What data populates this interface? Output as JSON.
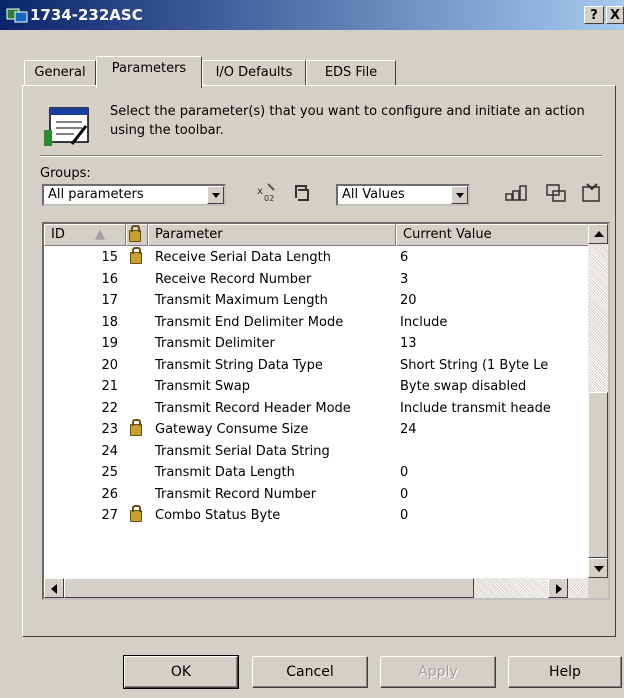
{
  "window": {
    "title": "1734-232ASC",
    "help_button": "?",
    "close_button": "X"
  },
  "tabs": [
    "General",
    "Parameters",
    "I/O Defaults",
    "EDS File"
  ],
  "active_tab": "Parameters",
  "instructions": "Select the parameter(s) that you want to configure and initiate an action using the toolbar.",
  "groups": {
    "label": "Groups:",
    "selected": "All parameters"
  },
  "values_filter": {
    "selected": "All Values"
  },
  "table": {
    "headers": {
      "id": "ID",
      "parameter": "Parameter",
      "current_value": "Current Value"
    },
    "rows": [
      {
        "id": "15",
        "locked": true,
        "parameter": "Receive Serial Data Length",
        "value": "6"
      },
      {
        "id": "16",
        "locked": false,
        "parameter": "Receive Record Number",
        "value": "3"
      },
      {
        "id": "17",
        "locked": false,
        "parameter": "Transmit Maximum Length",
        "value": "20"
      },
      {
        "id": "18",
        "locked": false,
        "parameter": "Transmit End Delimiter Mode",
        "value": "Include"
      },
      {
        "id": "19",
        "locked": false,
        "parameter": "Transmit Delimiter",
        "value": "13"
      },
      {
        "id": "20",
        "locked": false,
        "parameter": "Transmit String Data Type",
        "value": "Short String (1 Byte Le"
      },
      {
        "id": "21",
        "locked": false,
        "parameter": "Transmit Swap",
        "value": "Byte swap disabled"
      },
      {
        "id": "22",
        "locked": false,
        "parameter": "Transmit Record Header Mode",
        "value": "Include transmit heade"
      },
      {
        "id": "23",
        "locked": true,
        "parameter": "Gateway Consume Size",
        "value": "24"
      },
      {
        "id": "24",
        "locked": false,
        "parameter": "Transmit Serial Data String",
        "value": ""
      },
      {
        "id": "25",
        "locked": false,
        "parameter": "Transmit Data Length",
        "value": "0"
      },
      {
        "id": "26",
        "locked": false,
        "parameter": "Transmit Record Number",
        "value": "0"
      },
      {
        "id": "27",
        "locked": true,
        "parameter": "Combo Status Byte",
        "value": "0"
      }
    ]
  },
  "buttons": {
    "ok": "OK",
    "cancel": "Cancel",
    "apply": "Apply",
    "help": "Help"
  },
  "colors": {
    "title_bar_start": "#0a246a",
    "title_bar_end": "#a6caf0",
    "dialog_face": "#d4d0c8"
  }
}
